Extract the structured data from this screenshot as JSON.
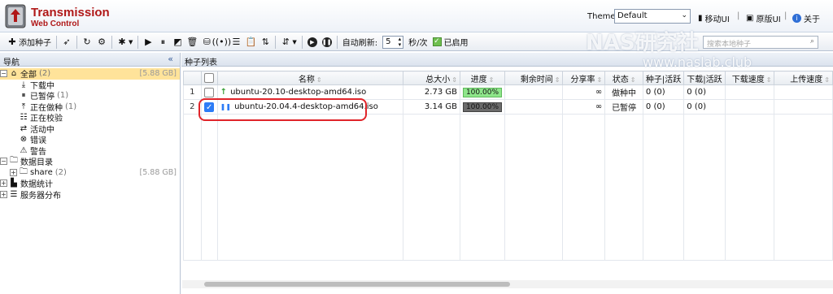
{
  "header": {
    "brand_line1": "Transmission",
    "brand_line2": "Web Control",
    "theme_label": "Theme:",
    "theme_value": "Default",
    "mobile_ui": "移动UI",
    "original_ui": "原版UI",
    "about": "关于",
    "separator": "|"
  },
  "toolbar": {
    "add_torrent": "添加种子",
    "auto_refresh_label": "自动刷新:",
    "refresh_value": "5",
    "refresh_unit": "秒/次",
    "enabled_label": "已启用",
    "search_placeholder": "搜索本地种子"
  },
  "nav": {
    "title": "导航",
    "items": [
      {
        "label": "全部",
        "count": "(2)",
        "size": "[5.88 GB]"
      },
      {
        "label": "下载中"
      },
      {
        "label": "已暂停",
        "count": "(1)"
      },
      {
        "label": "正在做种",
        "count": "(1)"
      },
      {
        "label": "正在校验"
      },
      {
        "label": "活动中"
      },
      {
        "label": "错误"
      },
      {
        "label": "警告"
      },
      {
        "label": "数据目录"
      },
      {
        "label": "share",
        "count": "(2)",
        "size": "[5.88 GB]"
      },
      {
        "label": "数据统计"
      },
      {
        "label": "服务器分布"
      }
    ]
  },
  "list": {
    "title": "种子列表",
    "columns": [
      "名称",
      "总大小",
      "进度",
      "剩余时间",
      "分享率",
      "状态",
      "种子|活跃",
      "下载|活跃",
      "下载速度",
      "上传速度"
    ],
    "rows": [
      {
        "num": "1",
        "name": "ubuntu-20.10-desktop-amd64.iso",
        "size": "2.73 GB",
        "progress": "100.00%",
        "ratio": "∞",
        "status": "做种中",
        "seeds": "0 (0)",
        "peers": "0 (0)",
        "checked": false
      },
      {
        "num": "2",
        "name": "ubuntu-20.04.4-desktop-amd64.iso",
        "size": "3.14 GB",
        "progress": "100.00%",
        "ratio": "∞",
        "status": "已暂停",
        "seeds": "0 (0)",
        "peers": "0 (0)",
        "checked": true
      }
    ]
  },
  "watermark": {
    "line1": "NAS研究社",
    "line2": "www.naslab.club"
  },
  "colors": {
    "brand": "#b01818",
    "progress_active": "#8ee68a",
    "progress_paused": "#6b6b6b",
    "highlight": "#e0242a",
    "nav_selected": "#ffe39a"
  }
}
